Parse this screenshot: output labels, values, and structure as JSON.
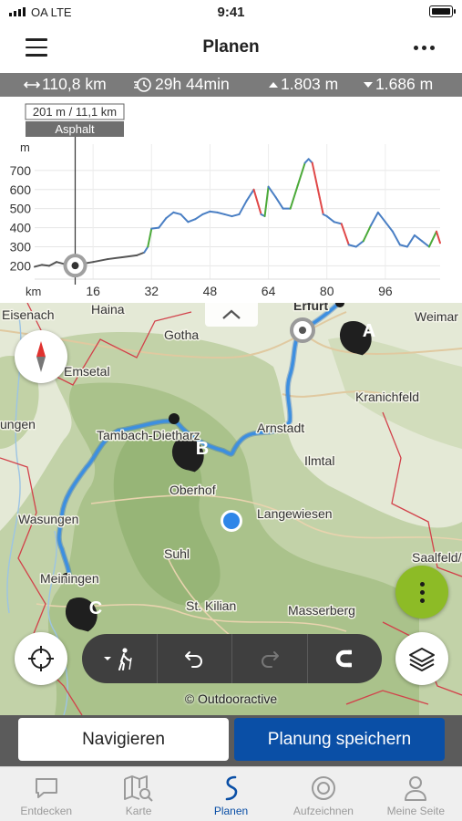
{
  "status_bar": {
    "carrier": "OA   LTE",
    "time": "9:41"
  },
  "header": {
    "title": "Planen",
    "menu_icon": "hamburger-icon",
    "more_icon": "more-dots-icon"
  },
  "stats": {
    "distance": "110,8 km",
    "duration": "29h 44min",
    "ascent": "1.803 m",
    "descent": "1.686 m"
  },
  "elevation": {
    "tooltip_value": "201 m / 11,1 km",
    "tooltip_surface": "Asphalt",
    "y_unit": "m",
    "x_unit": "km"
  },
  "chart_data": {
    "type": "line",
    "xlabel": "km",
    "ylabel": "m",
    "x_ticks": [
      16,
      32,
      48,
      64,
      80,
      96
    ],
    "y_ticks": [
      200,
      300,
      400,
      500,
      600,
      700
    ],
    "xlim": [
      0,
      111
    ],
    "ylim": [
      130,
      800
    ],
    "cursor": {
      "x": 11.1,
      "y": 201
    },
    "series": [
      {
        "x": [
          0,
          2,
          4,
          6,
          8,
          10,
          11.1,
          13,
          16,
          20,
          24,
          28,
          30,
          31,
          32,
          34,
          36,
          38,
          40,
          42,
          44,
          46,
          48,
          50,
          52,
          54,
          56,
          58,
          60,
          62,
          63,
          64,
          66,
          68,
          70,
          72,
          74,
          75,
          76,
          78,
          79,
          80,
          82,
          84,
          86,
          88,
          90,
          92,
          94,
          96,
          98,
          100,
          102,
          104,
          106,
          108,
          110,
          111
        ],
        "y": [
          195,
          205,
          200,
          220,
          210,
          205,
          201,
          210,
          220,
          235,
          245,
          255,
          270,
          300,
          395,
          400,
          450,
          480,
          470,
          430,
          445,
          470,
          485,
          480,
          470,
          460,
          470,
          540,
          600,
          470,
          460,
          615,
          560,
          500,
          500,
          620,
          740,
          760,
          740,
          560,
          470,
          460,
          430,
          420,
          310,
          300,
          330,
          410,
          480,
          430,
          380,
          310,
          300,
          360,
          330,
          300,
          380,
          320
        ]
      }
    ]
  },
  "map": {
    "places": [
      "Eisenach",
      "Haina",
      "Gotha",
      "Erfurt",
      "Weimar",
      "Emsetal",
      "Kranichfeld",
      "Arnstadt",
      "ungen",
      "Tambach-Dietharz",
      "Ilmtal",
      "Oberhof",
      "Wasungen",
      "Langewiesen",
      "Saalfeld/Sa",
      "Suhl",
      "Meiningen",
      "St. Kilian",
      "Masserberg"
    ],
    "waypoints": [
      "A",
      "B",
      "C"
    ],
    "copyright": "© Outdooractive"
  },
  "toolbar": {
    "mode_icon": "hiking-icon",
    "undo_icon": "undo-icon",
    "redo_icon": "redo-icon",
    "snap_icon": "magnet-icon"
  },
  "actions": {
    "navigate": "Navigieren",
    "save": "Planung speichern"
  },
  "tabs": [
    {
      "label": "Entdecken",
      "icon": "chat-bubble-icon",
      "active": false
    },
    {
      "label": "Karte",
      "icon": "map-search-icon",
      "active": false
    },
    {
      "label": "Planen",
      "icon": "route-icon",
      "active": true
    },
    {
      "label": "Aufzeichnen",
      "icon": "record-icon",
      "active": false
    },
    {
      "label": "Meine Seite",
      "icon": "person-icon",
      "active": false
    }
  ],
  "colors": {
    "accent": "#0a4fa6",
    "route": "#3d8fe0",
    "fab": "#8dbb26",
    "stats_bg": "#7b7b7b"
  }
}
